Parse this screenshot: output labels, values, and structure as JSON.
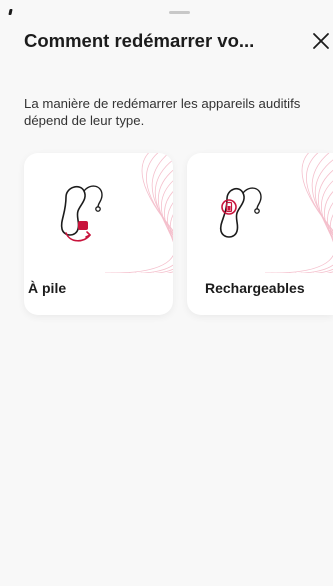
{
  "header": {
    "title": "Comment redémarrer vo...",
    "close_icon": "close-icon"
  },
  "description": "La manière de redémarrer les appareils auditifs dépend de leur type.",
  "options": [
    {
      "label": "À pile",
      "icon": "battery-hearing-aid-icon"
    },
    {
      "label": "Rechargeables",
      "icon": "rechargeable-hearing-aid-icon"
    }
  ],
  "colors": {
    "accent": "#c8143c",
    "wave": "#f3b5c4",
    "text": "#1c1c1c"
  }
}
